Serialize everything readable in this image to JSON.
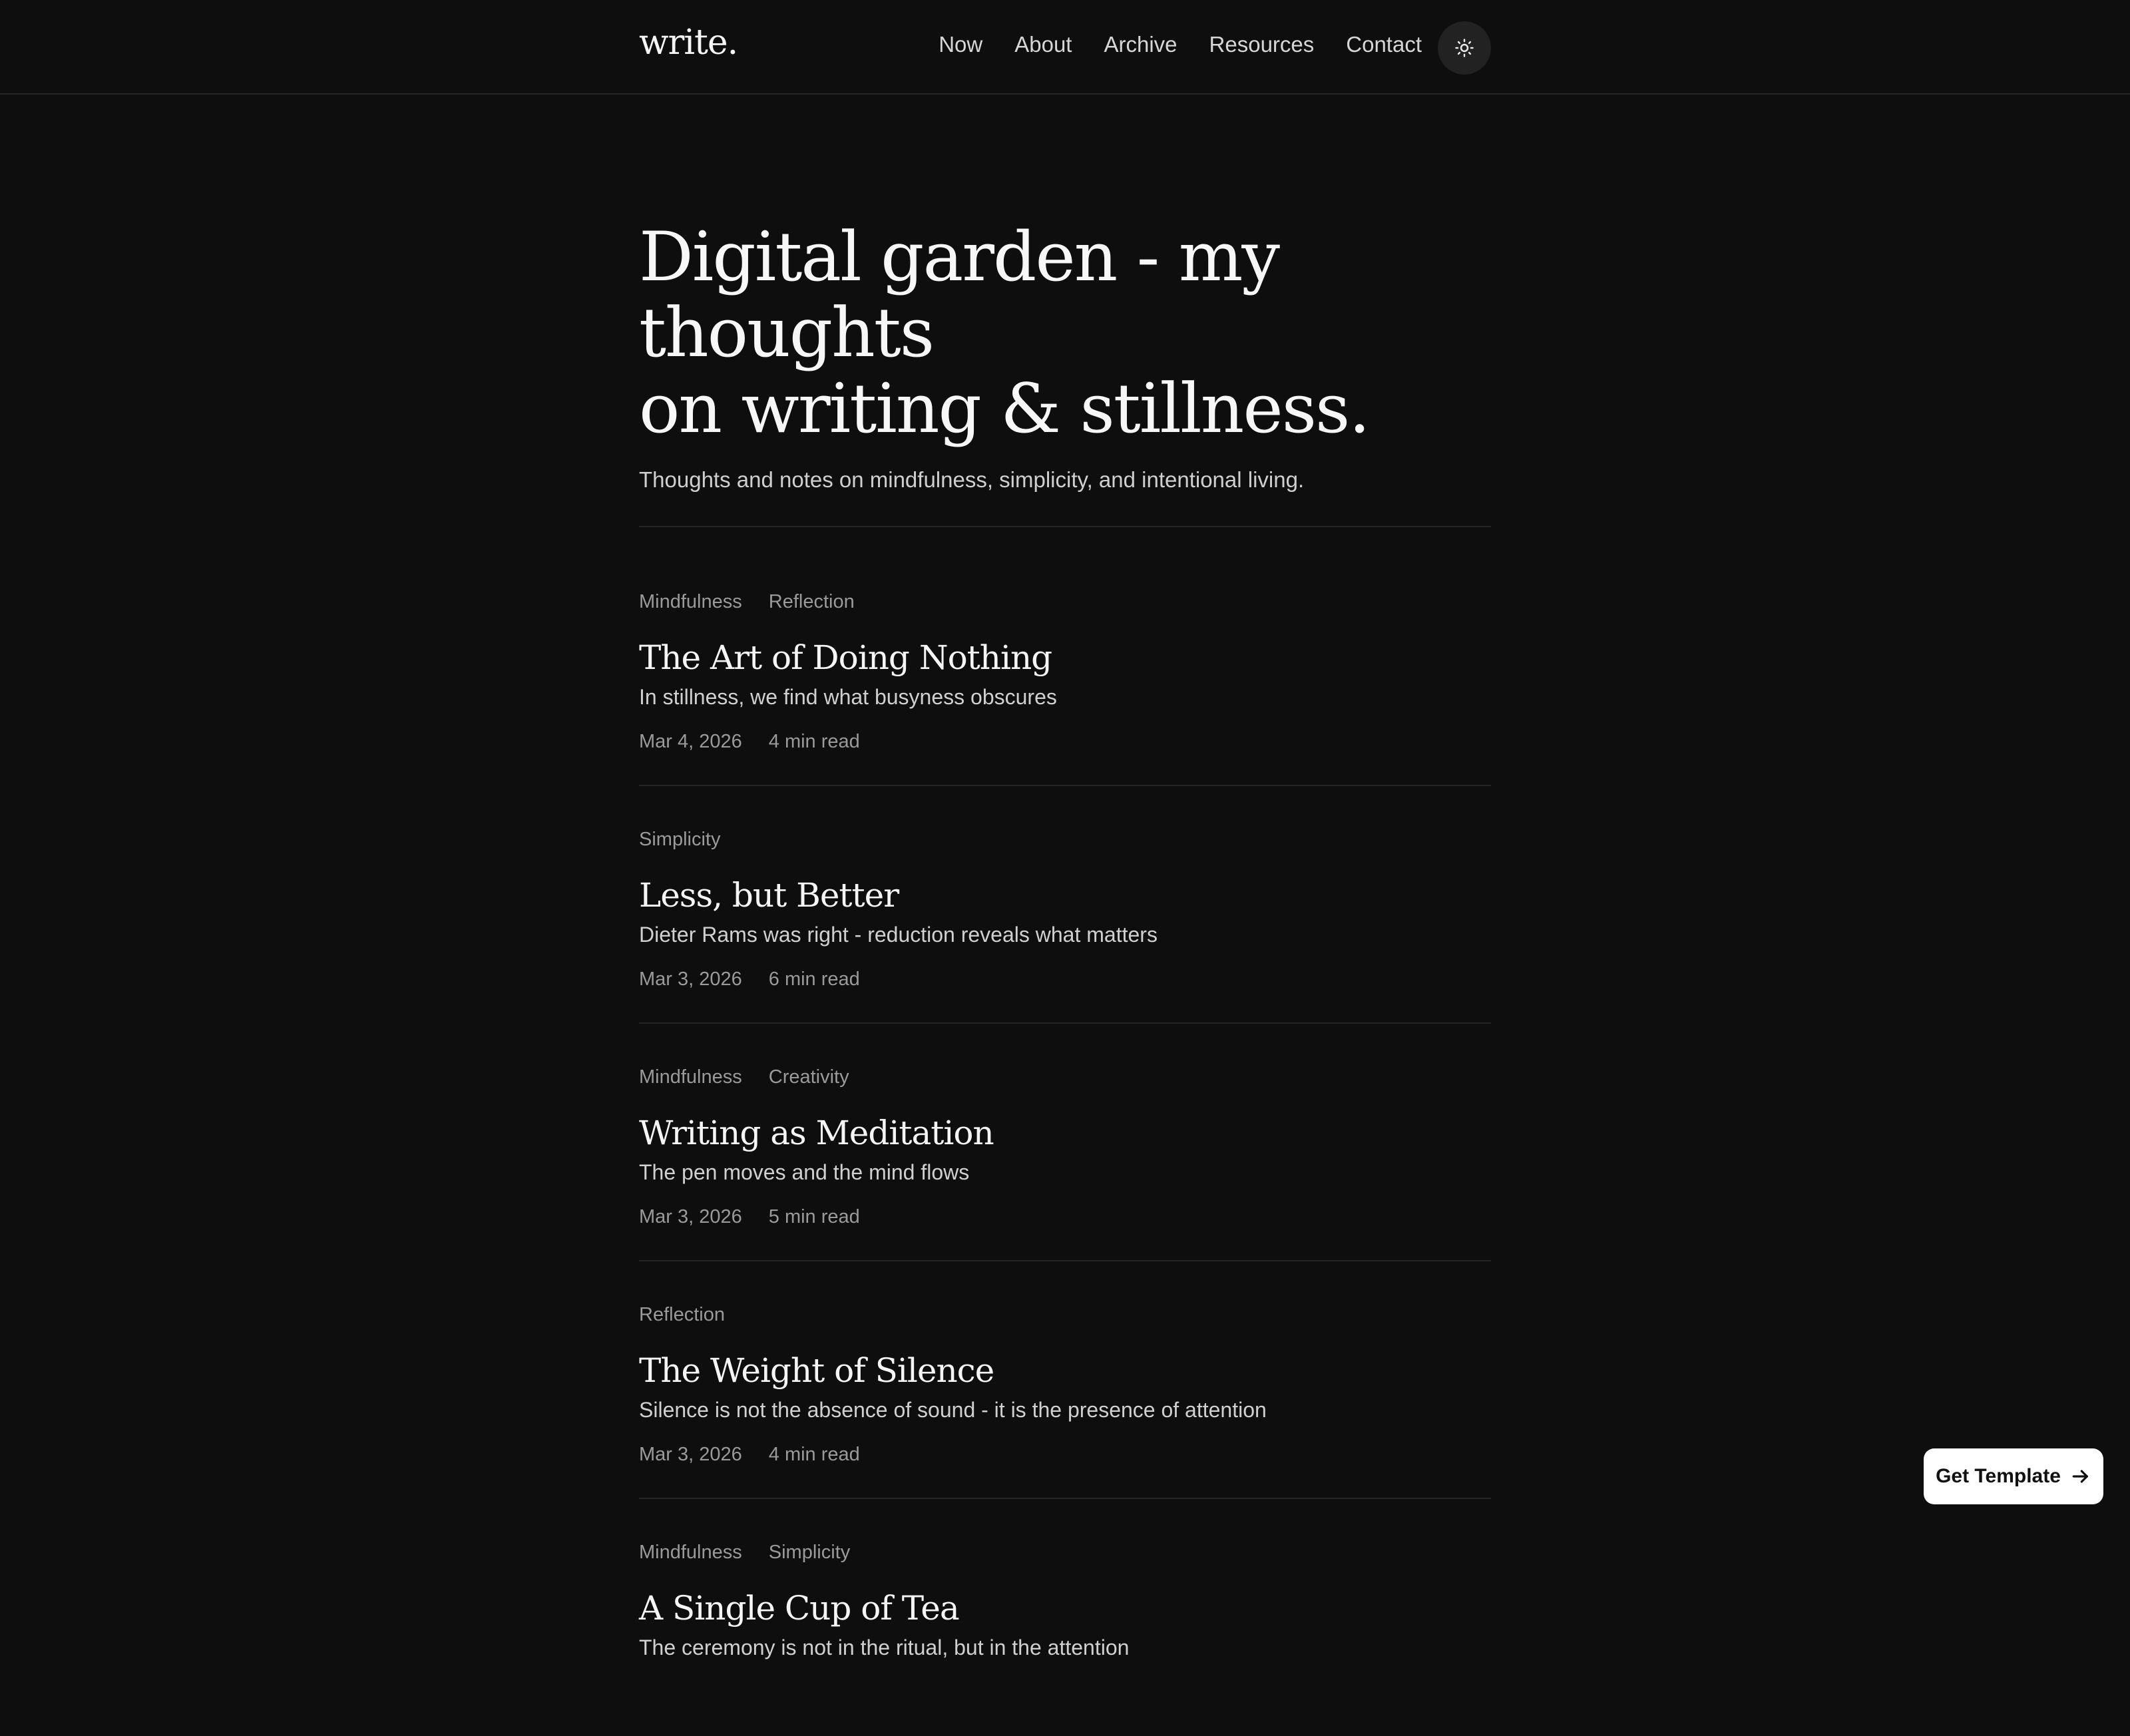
{
  "header": {
    "logo": "write.",
    "nav": [
      "Now",
      "About",
      "Archive",
      "Resources",
      "Contact"
    ],
    "theme_toggle_icon": "sun-icon"
  },
  "hero": {
    "title_line1": "Digital garden - my thoughts",
    "title_line2": "on writing & stillness.",
    "subtitle": "Thoughts and notes on mindfulness, simplicity, and intentional living."
  },
  "posts": [
    {
      "tags": [
        "Mindfulness",
        "Reflection"
      ],
      "title": "The Art of Doing Nothing",
      "excerpt": "In stillness, we find what busyness obscures",
      "date": "Mar 4, 2026",
      "read_time": "4 min read"
    },
    {
      "tags": [
        "Simplicity"
      ],
      "title": "Less, but Better",
      "excerpt": "Dieter Rams was right - reduction reveals what matters",
      "date": "Mar 3, 2026",
      "read_time": "6 min read"
    },
    {
      "tags": [
        "Mindfulness",
        "Creativity"
      ],
      "title": "Writing as Meditation",
      "excerpt": "The pen moves and the mind flows",
      "date": "Mar 3, 2026",
      "read_time": "5 min read"
    },
    {
      "tags": [
        "Reflection"
      ],
      "title": "The Weight of Silence",
      "excerpt": "Silence is not the absence of sound - it is the presence of attention",
      "date": "Mar 3, 2026",
      "read_time": "4 min read"
    },
    {
      "tags": [
        "Mindfulness",
        "Simplicity"
      ],
      "title": "A Single Cup of Tea",
      "excerpt": "The ceremony is not in the ritual, but in the attention"
    }
  ],
  "cta": {
    "label": "Get Template",
    "icon": "arrow-right-icon"
  },
  "colors": {
    "background": "#0e0e0e",
    "text": "#f4f4f4",
    "muted": "#9a9a9a",
    "divider": "#262626",
    "cta_bg": "#ffffff"
  }
}
